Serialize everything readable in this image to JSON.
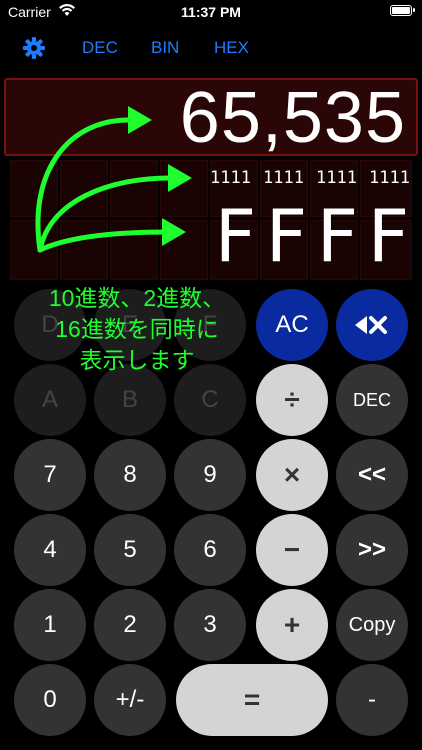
{
  "status_bar": {
    "carrier": "Carrier",
    "time": "11:37 PM",
    "battery_level": 1.0,
    "wifi_icon": "wifi-icon",
    "battery_icon": "battery-icon"
  },
  "toolbar": {
    "settings_icon": "gear-icon",
    "modes": [
      "DEC",
      "BIN",
      "HEX"
    ],
    "accent_color": "#1e7cff"
  },
  "display": {
    "decimal_value": "65,535",
    "binary_groups": [
      "1111",
      "1111",
      "1111",
      "1111"
    ],
    "hex_digits": [
      "F",
      "F",
      "F",
      "F"
    ]
  },
  "annotation": {
    "lines": [
      "10進数、2進数、",
      "16進数を同時に",
      "表示します"
    ],
    "color": "#1fff2e"
  },
  "keypad": {
    "hex_row1": [
      "D",
      "E",
      "F"
    ],
    "hex_row2": [
      "A",
      "B",
      "C"
    ],
    "ac": "AC",
    "backspace_icon": "backspace-icon",
    "divide": "÷",
    "dec": "DEC",
    "seven": "7",
    "eight": "8",
    "nine": "9",
    "multiply": "×",
    "shift_left": "<<",
    "four": "4",
    "five": "5",
    "six": "6",
    "minus": "−",
    "shift_right": ">>",
    "one": "1",
    "two": "2",
    "three": "3",
    "plus": "+",
    "copy": "Copy",
    "zero": "0",
    "negate": "+/-",
    "equals": "=",
    "dash": "-"
  }
}
